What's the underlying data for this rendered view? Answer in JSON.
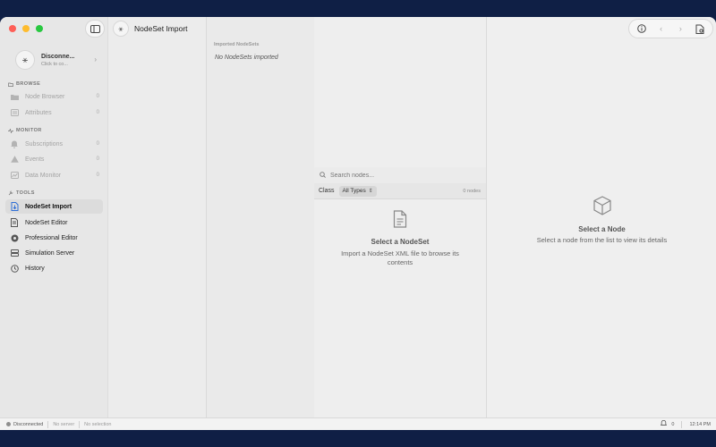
{
  "window": {
    "title": "NodeSet Import"
  },
  "connection": {
    "title": "Disconne...",
    "subtitle": "Click to co..."
  },
  "sidebar": {
    "sections": [
      {
        "title": "BROWSE",
        "items": [
          {
            "label": "Node Browser",
            "count": "0",
            "icon": "folder-icon",
            "state": "disabled"
          },
          {
            "label": "Attributes",
            "count": "0",
            "icon": "list-icon",
            "state": "disabled"
          }
        ]
      },
      {
        "title": "MONITOR",
        "items": [
          {
            "label": "Subscriptions",
            "count": "0",
            "icon": "bell-icon",
            "state": "disabled"
          },
          {
            "label": "Events",
            "count": "0",
            "icon": "warning-icon",
            "state": "disabled"
          },
          {
            "label": "Data Monitor",
            "count": "0",
            "icon": "chart-icon",
            "state": "disabled"
          }
        ]
      },
      {
        "title": "TOOLS",
        "items": [
          {
            "label": "NodeSet Import",
            "icon": "import-icon",
            "state": "active"
          },
          {
            "label": "NodeSet Editor",
            "icon": "document-icon",
            "state": "normal"
          },
          {
            "label": "Professional Editor",
            "icon": "gear-icon",
            "state": "normal"
          },
          {
            "label": "Simulation Server",
            "icon": "server-icon",
            "state": "normal"
          },
          {
            "label": "History",
            "icon": "clock-icon",
            "state": "normal"
          }
        ]
      }
    ]
  },
  "imported": {
    "header": "Imported NodeSets",
    "empty": "No NodeSets imported"
  },
  "nodes": {
    "search_placeholder": "Search nodes...",
    "class_label": "Class",
    "class_value": "All Types",
    "count": "0 nodes",
    "empty_title": "Select a NodeSet",
    "empty_body": "Import a NodeSet XML file to browse its contents"
  },
  "detail": {
    "empty_title": "Select a Node",
    "empty_body": "Select a node from the list to view its details"
  },
  "status": {
    "connection": "Disconnected",
    "server": "No server",
    "selection": "No selection",
    "notifications": "0",
    "time": "12:14 PM"
  },
  "colors": {
    "background": "#0f1f45",
    "accent": "#2f6fd6"
  }
}
